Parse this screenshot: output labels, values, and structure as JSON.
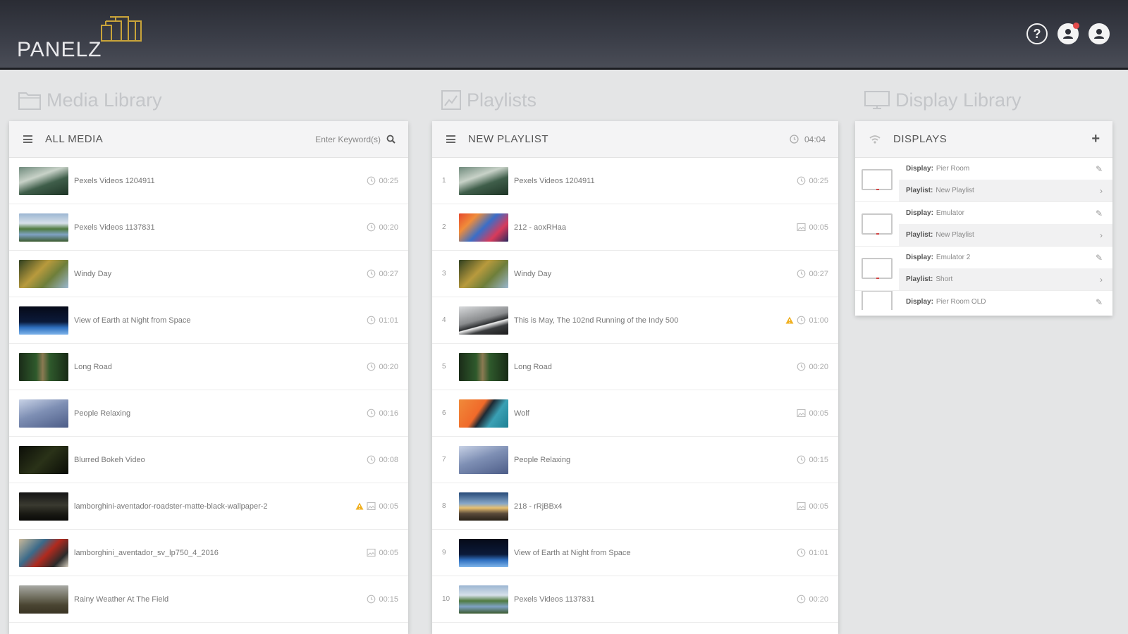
{
  "header": {
    "logo_text": "PANELZ",
    "icons": [
      "help-icon",
      "notifications-icon",
      "user-icon"
    ],
    "help_glyph": "?",
    "accent_logo": "#c9a43a"
  },
  "media_library": {
    "section_title": "Media Library",
    "panel_title": "ALL MEDIA",
    "search_placeholder": "Enter Keyword(s)",
    "items": [
      {
        "title": "Pexels Videos 1204911",
        "duration": "00:25",
        "type": "video",
        "thumb": "mountain"
      },
      {
        "title": "Pexels Videos 1137831",
        "duration": "00:20",
        "type": "video",
        "thumb": "lake"
      },
      {
        "title": "Windy Day",
        "duration": "00:27",
        "type": "video",
        "thumb": "tree"
      },
      {
        "title": "View of Earth at Night from Space",
        "duration": "01:01",
        "type": "video",
        "thumb": "earth"
      },
      {
        "title": "Long Road",
        "duration": "00:20",
        "type": "video",
        "thumb": "road"
      },
      {
        "title": "People Relaxing",
        "duration": "00:16",
        "type": "video",
        "thumb": "sky"
      },
      {
        "title": "Blurred Bokeh Video",
        "duration": "00:08",
        "type": "video",
        "thumb": "dark"
      },
      {
        "title": "lamborghini-aventador-roadster-matte-black-wallpaper-2",
        "duration": "00:05",
        "type": "image",
        "thumb": "car",
        "warning": true
      },
      {
        "title": "lamborghini_aventador_sv_lp750_4_2016",
        "duration": "00:05",
        "type": "image",
        "thumb": "redcar"
      },
      {
        "title": "Rainy Weather At The Field",
        "duration": "00:15",
        "type": "video",
        "thumb": "field"
      }
    ]
  },
  "playlists": {
    "section_title": "Playlists",
    "panel_title": "NEW PLAYLIST",
    "total_duration": "04:04",
    "items": [
      {
        "index": "1",
        "title": "Pexels Videos 1204911",
        "duration": "00:25",
        "type": "video",
        "thumb": "mountain"
      },
      {
        "index": "2",
        "title": "212 - aoxRHaa",
        "duration": "00:05",
        "type": "image",
        "thumb": "colorful"
      },
      {
        "index": "3",
        "title": "Windy Day",
        "duration": "00:27",
        "type": "video",
        "thumb": "tree"
      },
      {
        "index": "4",
        "title": "This is May, The 102nd Running of the Indy 500",
        "duration": "01:00",
        "type": "video",
        "thumb": "race",
        "warning": true
      },
      {
        "index": "5",
        "title": "Long Road",
        "duration": "00:20",
        "type": "video",
        "thumb": "road"
      },
      {
        "index": "6",
        "title": "Wolf",
        "duration": "00:05",
        "type": "image",
        "thumb": "wolf"
      },
      {
        "index": "7",
        "title": "People Relaxing",
        "duration": "00:15",
        "type": "video",
        "thumb": "sky"
      },
      {
        "index": "8",
        "title": "218 - rRjBBx4",
        "duration": "00:05",
        "type": "image",
        "thumb": "city"
      },
      {
        "index": "9",
        "title": "View of Earth at Night from Space",
        "duration": "01:01",
        "type": "video",
        "thumb": "earth"
      },
      {
        "index": "10",
        "title": "Pexels Videos 1137831",
        "duration": "00:20",
        "type": "video",
        "thumb": "lake"
      }
    ]
  },
  "display_library": {
    "section_title": "Display Library",
    "panel_title": "DISPLAYS",
    "add_glyph": "+",
    "display_label": "Display:",
    "playlist_label": "Playlist:",
    "edit_glyph": "✎",
    "open_glyph": "›",
    "displays": [
      {
        "name": "Pier Room",
        "playlist": "New Playlist"
      },
      {
        "name": "Emulator",
        "playlist": "New Playlist"
      },
      {
        "name": "Emulator 2",
        "playlist": "Short"
      },
      {
        "name": "Pier Room OLD",
        "playlist": ""
      }
    ]
  }
}
